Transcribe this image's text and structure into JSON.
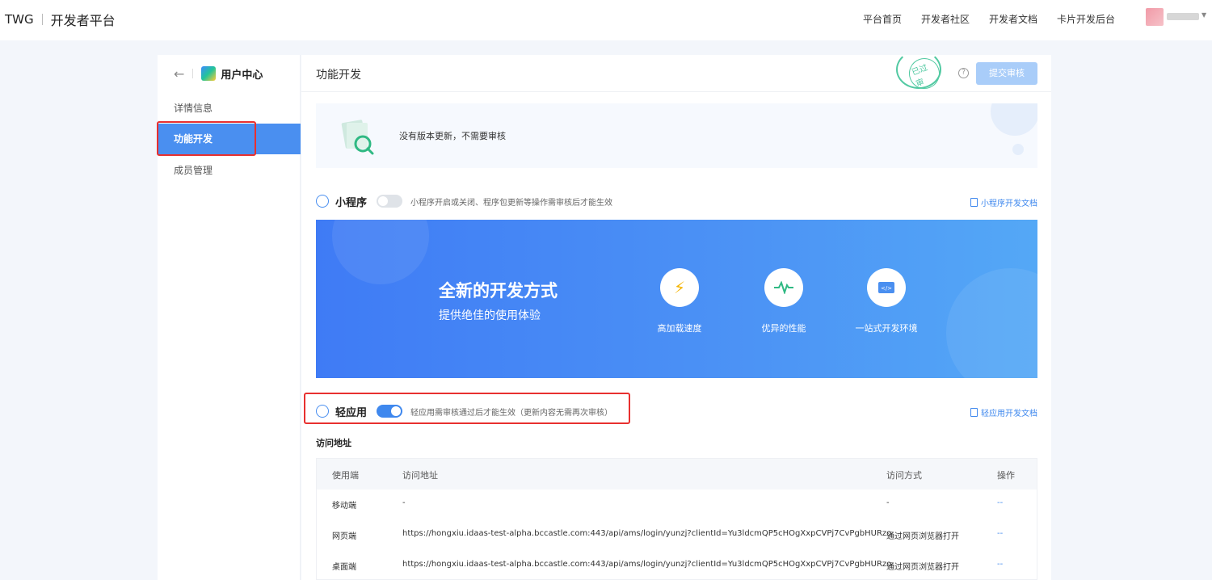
{
  "topbar": {
    "brand": "TWG",
    "platform": "开发者平台",
    "nav": [
      "平台首页",
      "开发者社区",
      "开发者文档",
      "卡片开发后台"
    ]
  },
  "sidebar": {
    "app_name": "用户中心",
    "items": [
      {
        "label": "详情信息"
      },
      {
        "label": "功能开发"
      },
      {
        "label": "成员管理"
      }
    ]
  },
  "main": {
    "title": "功能开发",
    "stamp": "已过审",
    "submit_label": "提交审核",
    "notice": "没有版本更新，不需要审核",
    "mini_program": {
      "title": "小程序",
      "desc": "小程序开启或关闭、程序包更新等操作需审核后才能生效",
      "doc_link": "小程序开发文档",
      "enabled": false
    },
    "banner": {
      "title": "全新的开发方式",
      "subtitle": "提供绝佳的使用体验",
      "features": [
        {
          "icon": "lightning-icon",
          "label": "高加载速度"
        },
        {
          "icon": "pulse-icon",
          "label": "优异的性能"
        },
        {
          "icon": "code-icon",
          "label": "一站式开发环境"
        }
      ]
    },
    "light_app": {
      "title": "轻应用",
      "desc": "轻应用需审核通过后才能生效（更新内容无需再次审核）",
      "doc_link": "轻应用开发文档",
      "enabled": true
    },
    "access": {
      "label": "访问地址",
      "columns": [
        "使用端",
        "访问地址",
        "访问方式",
        "操作"
      ],
      "rows": [
        {
          "client": "移动端",
          "url": "-",
          "method": "-",
          "op": "--"
        },
        {
          "client": "网页端",
          "url": "https://hongxiu.idaas-test-alpha.bccastle.com:443/api/ams/login/yunzj?clientId=Yu3ldcmQP5cHOgXxpCVPj7CvPgbHURzo",
          "method": "通过网页浏览器打开",
          "op": "--"
        },
        {
          "client": "桌面端",
          "url": "https://hongxiu.idaas-test-alpha.bccastle.com:443/api/ams/login/yunzj?clientId=Yu3ldcmQP5cHOgXxpCVPj7CvPgbHURzo",
          "method": "通过网页浏览器打开",
          "op": "--"
        }
      ]
    }
  },
  "colors": {
    "accent": "#4a8ff0",
    "highlight_box": "#e8302f",
    "stamp": "#52c9a2"
  }
}
